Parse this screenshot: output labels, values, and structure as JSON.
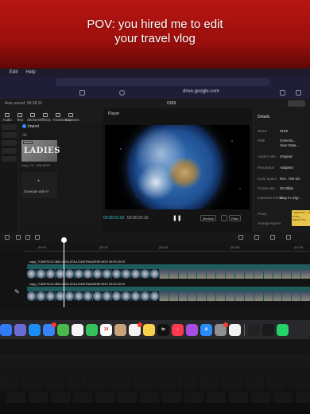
{
  "caption": {
    "line1": "POV: you hired me to edit",
    "line2": "your travel vlog"
  },
  "menubar": [
    "",
    "Edit",
    "Help"
  ],
  "browser": {
    "address": "drive.google.com"
  },
  "app": {
    "autosave": "Auto saved: 08:38:31",
    "project_title": "0109",
    "toolbar": [
      "Audio",
      "Text",
      "Stickers",
      "Effects",
      "Transitions",
      "Captions"
    ]
  },
  "media": {
    "import_label": "Import",
    "all_label": "All",
    "thumb_badge": "Added",
    "thumb_text": "LADIES",
    "thumb_name": "copy_7C...000.MOV",
    "generate_label": "Generate with AI"
  },
  "player": {
    "header": "Player",
    "time_current": "00:00:01:02",
    "time_total": "00:00:20:10",
    "chip_medium": "Medium",
    "chip_ratio": "Ratio"
  },
  "details": {
    "header": "Details",
    "rows": [
      {
        "k": "Name",
        "v": "0109"
      },
      {
        "k": "Path",
        "v": "/Users/a..."
      },
      {
        "k": "",
        "v": "User Data..."
      },
      {
        "k": "Aspect ratio",
        "v": "Original"
      },
      {
        "k": "Resolution",
        "v": "Adapted"
      },
      {
        "k": "Color space",
        "v": "Rec. 709 SD"
      },
      {
        "k": "Frame rate",
        "v": "30.00fps"
      },
      {
        "k": "Imported media",
        "v": "Stay in origi..."
      },
      {
        "k": "Proxy",
        "v": ""
      },
      {
        "k": "Arrange layers",
        "v": ""
      }
    ],
    "note": "Layers ca... in every ... layout Dra..."
  },
  "timeline": {
    "ruler": [
      "00:00",
      "|00:02",
      "|00:04",
      "|00:06",
      "|00:08"
    ],
    "track1_label": "copy_7C8AF0C5-C863-4E0A-87A4-D4347BAA3E9E.MOV    00:00:20:10",
    "track2_label": "copy_7C8AF0C5-C863-4E0A-87A4-D4347BAA3E9E.MOV    00:00:20:10"
  },
  "dock": {
    "apps": [
      {
        "name": "finder",
        "color": "#2f7cf6",
        "glyph": ""
      },
      {
        "name": "launchpad",
        "color": "#6b6bd6",
        "glyph": ""
      },
      {
        "name": "safari",
        "color": "#1c8df2",
        "glyph": ""
      },
      {
        "name": "mail",
        "color": "#3a82f7",
        "glyph": ""
      },
      {
        "name": "maps",
        "color": "#4cb84c",
        "glyph": ""
      },
      {
        "name": "photos",
        "color": "#f5f5f5",
        "glyph": ""
      },
      {
        "name": "facetime",
        "color": "#36c25a",
        "glyph": ""
      },
      {
        "name": "calendar",
        "color": "#fafafa",
        "glyph": "19"
      },
      {
        "name": "contacts",
        "color": "#c9a27a",
        "glyph": ""
      },
      {
        "name": "reminders",
        "color": "#f2f2f2",
        "glyph": ""
      },
      {
        "name": "notes",
        "color": "#f6d34a",
        "glyph": ""
      },
      {
        "name": "tv",
        "color": "#111111",
        "glyph": "tv"
      },
      {
        "name": "music",
        "color": "#fa3b4f",
        "glyph": "♪"
      },
      {
        "name": "podcasts",
        "color": "#a54ee0",
        "glyph": ""
      },
      {
        "name": "app-store",
        "color": "#2a8cf8",
        "glyph": "A"
      },
      {
        "name": "settings",
        "color": "#8e8e93",
        "glyph": ""
      },
      {
        "name": "capcut",
        "color": "#f2f2f2",
        "glyph": ""
      },
      {
        "name": "screen-recorder",
        "color": "#222222",
        "glyph": ""
      },
      {
        "name": "terminal",
        "color": "#1a1a1a",
        "glyph": ""
      },
      {
        "name": "whatsapp",
        "color": "#25d366",
        "glyph": ""
      }
    ]
  }
}
